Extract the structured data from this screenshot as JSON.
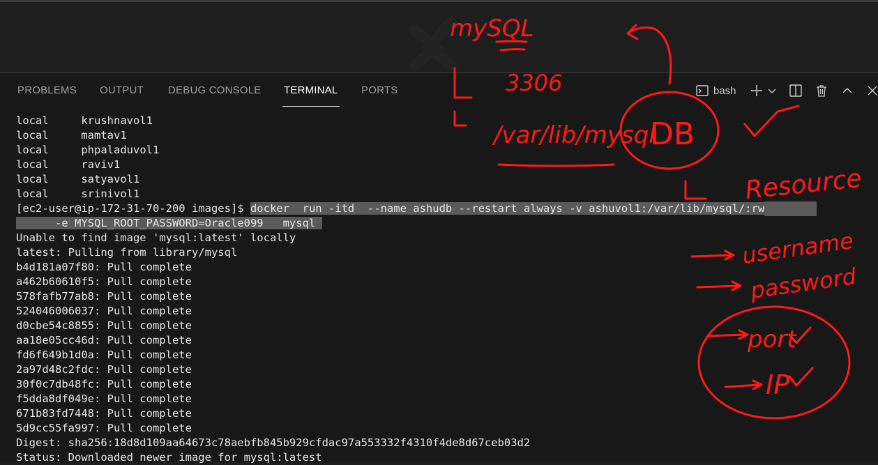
{
  "tabs": [
    {
      "label": "PROBLEMS"
    },
    {
      "label": "OUTPUT"
    },
    {
      "label": "DEBUG CONSOLE"
    },
    {
      "label": "TERMINAL"
    },
    {
      "label": "PORTS"
    }
  ],
  "active_tab": "TERMINAL",
  "actions": {
    "shell_label": "bash",
    "icons": [
      "terminal-icon",
      "plus-icon",
      "chevron-down-icon",
      "split-icon",
      "trash-icon",
      "chevron-up-icon",
      "close-icon"
    ]
  },
  "terminal": {
    "volumes": [
      {
        "driver": "local",
        "name": "krushnavol1"
      },
      {
        "driver": "local",
        "name": "mamtav1"
      },
      {
        "driver": "local",
        "name": "phpaladuvol1"
      },
      {
        "driver": "local",
        "name": "raviv1"
      },
      {
        "driver": "local",
        "name": "satyavol1"
      },
      {
        "driver": "local",
        "name": "srinivol1"
      }
    ],
    "prompt": "[ec2-user@ip-172-31-70-200 images]$ ",
    "command_line1": "docker  run -itd  --name ashudb --restart always -v ashuvol1:/var/lib/mysql/:rw",
    "command_line2": "      -e MYSQL_ROOT_PASSWORD=Oracle099   mysql ",
    "output": [
      "Unable to find image 'mysql:latest' locally",
      "latest: Pulling from library/mysql",
      "b4d181a07f80: Pull complete",
      "a462b60610f5: Pull complete",
      "578fafb77ab8: Pull complete",
      "524046006037: Pull complete",
      "d0cbe54c8855: Pull complete",
      "aa18e05cc46d: Pull complete",
      "fd6f649b1d0a: Pull complete",
      "2a97d48c2fdc: Pull complete",
      "30f0c7db48fc: Pull complete",
      "f5dda8df049e: Pull complete",
      "671b83fd7448: Pull complete",
      "5d9cc55fa997: Pull complete",
      "Digest: sha256:18d8d109aa64673c78aebfb845b929cfdac97a553332f4310f4de8d67ceb03d2",
      "Status: Downloaded newer image for mysql:latest"
    ]
  },
  "annotations": {
    "title": "mySQL",
    "port": "3306",
    "path": "/var/lib/mysql",
    "db": "DB",
    "resource": "Resource",
    "username": "username",
    "password": "password",
    "port_label": "port",
    "ip": "IP"
  },
  "colors": {
    "background": "#181818",
    "editor": "#1e1e1e",
    "selection": "#5a5a5a",
    "annotation": "#ff1a1a"
  }
}
